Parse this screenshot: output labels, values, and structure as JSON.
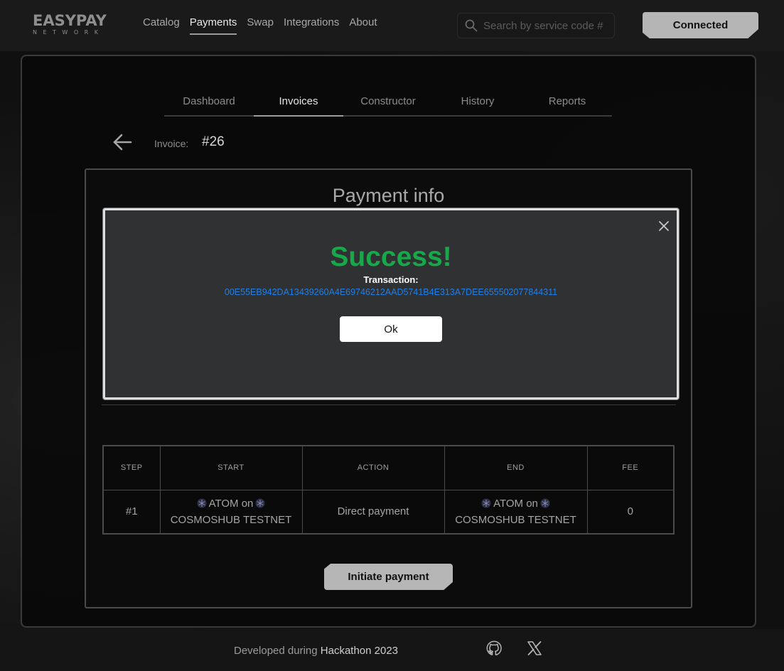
{
  "brand": {
    "name": "EASYPAY",
    "sub": "NETWORK"
  },
  "nav": [
    "Catalog",
    "Payments",
    "Swap",
    "Integrations",
    "About"
  ],
  "search": {
    "placeholder": "Search by service code #"
  },
  "connect_label": "Connected",
  "tabs": [
    "Dashboard",
    "Invoices",
    "Constructor",
    "History",
    "Reports"
  ],
  "invoice": {
    "label": "Invoice:",
    "number": "#26"
  },
  "panel_title": "Payment info",
  "modal": {
    "title": "Success!",
    "tx_label": "Transaction:",
    "tx_hash": "00E55EB942DA13439260A4E69746212AAD5741B4E313A7DEE655502077844311",
    "ok_label": "Ok"
  },
  "table": {
    "headers": [
      "STEP",
      "START",
      "ACTION",
      "END",
      "FEE"
    ],
    "row": {
      "step": "#1",
      "start_token": "ATOM on",
      "start_chain": "COSMOSHUB TESTNET",
      "action": "Direct payment",
      "end_token": "ATOM on",
      "end_chain": "COSMOSHUB TESTNET",
      "fee": "0"
    }
  },
  "initiate_label": "Initiate payment",
  "footer": {
    "prefix": "Developed during",
    "event": "Hackathon 2023"
  },
  "icons": [
    "search-icon",
    "back-arrow-icon",
    "close-icon",
    "atom-icon",
    "github-icon",
    "x-icon"
  ],
  "colors": {
    "success": "#17a84a",
    "link": "#1f7fe8",
    "button": "#b6b6b6"
  }
}
